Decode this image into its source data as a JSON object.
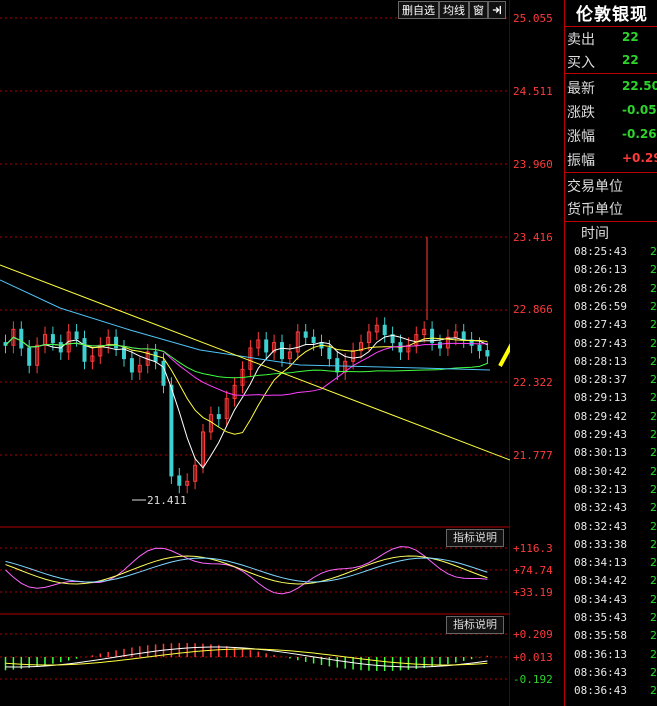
{
  "toolbar": {
    "delete_watch": "删自选",
    "ma_lines": "均线",
    "window": "窗",
    "pin_icon": "pin-right-icon"
  },
  "price_axis": {
    "labels": [
      "25.055",
      "24.511",
      "23.960",
      "23.416",
      "22.866",
      "22.322",
      "21.777"
    ],
    "colors": {
      "up": "#ff3a3a",
      "down": "#2cd52c"
    }
  },
  "main_chart": {
    "low_marker": "21.411",
    "colors": {
      "candle_up": "#ff3a3a",
      "candle_down": "#3fd0d0",
      "ma5": "#ffffff",
      "ma10": "#ffff40",
      "ma20": "#ff40ff",
      "ma60": "#40ff40",
      "ma120": "#4fc3f7",
      "trendline": "#ffff40",
      "annotation_arrow": "#ffff00",
      "grid": "#b00000"
    }
  },
  "indicator1": {
    "button": "指标说明",
    "labels": [
      "+116.3",
      "+74.74",
      "+33.19"
    ]
  },
  "indicator2": {
    "button": "指标说明",
    "labels": [
      "+0.209",
      "+0.013",
      "-0.192"
    ]
  },
  "side": {
    "title": "伦敦银现",
    "quote_rows": [
      {
        "label": "卖出",
        "value": "22",
        "color": "#2cd52c"
      },
      {
        "label": "买入",
        "value": "22",
        "color": "#2cd52c"
      }
    ],
    "stat_rows": [
      {
        "label": "最新",
        "value": "22.50",
        "color": "#2cd52c"
      },
      {
        "label": "涨跌",
        "value": "-0.05",
        "color": "#2cd52c"
      },
      {
        "label": "涨幅",
        "value": "-0.26",
        "color": "#2cd52c"
      },
      {
        "label": "振幅",
        "value": "+0.29",
        "color": "#ff3a3a"
      }
    ],
    "unit_rows": [
      {
        "label": "交易单位"
      },
      {
        "label": "货币单位"
      }
    ],
    "tick_header": "时间",
    "ticks": [
      "08:25:43",
      "08:26:13",
      "08:26:28",
      "08:26:59",
      "08:27:43",
      "08:27:43",
      "08:28:13",
      "08:28:37",
      "08:29:13",
      "08:29:42",
      "08:29:43",
      "08:30:13",
      "08:30:42",
      "08:32:13",
      "08:32:43",
      "08:32:43",
      "08:33:38",
      "08:34:13",
      "08:34:42",
      "08:34:43",
      "08:35:43",
      "08:35:58",
      "08:36:13",
      "08:36:43",
      "08:36:43"
    ],
    "tick_side": "2"
  }
}
